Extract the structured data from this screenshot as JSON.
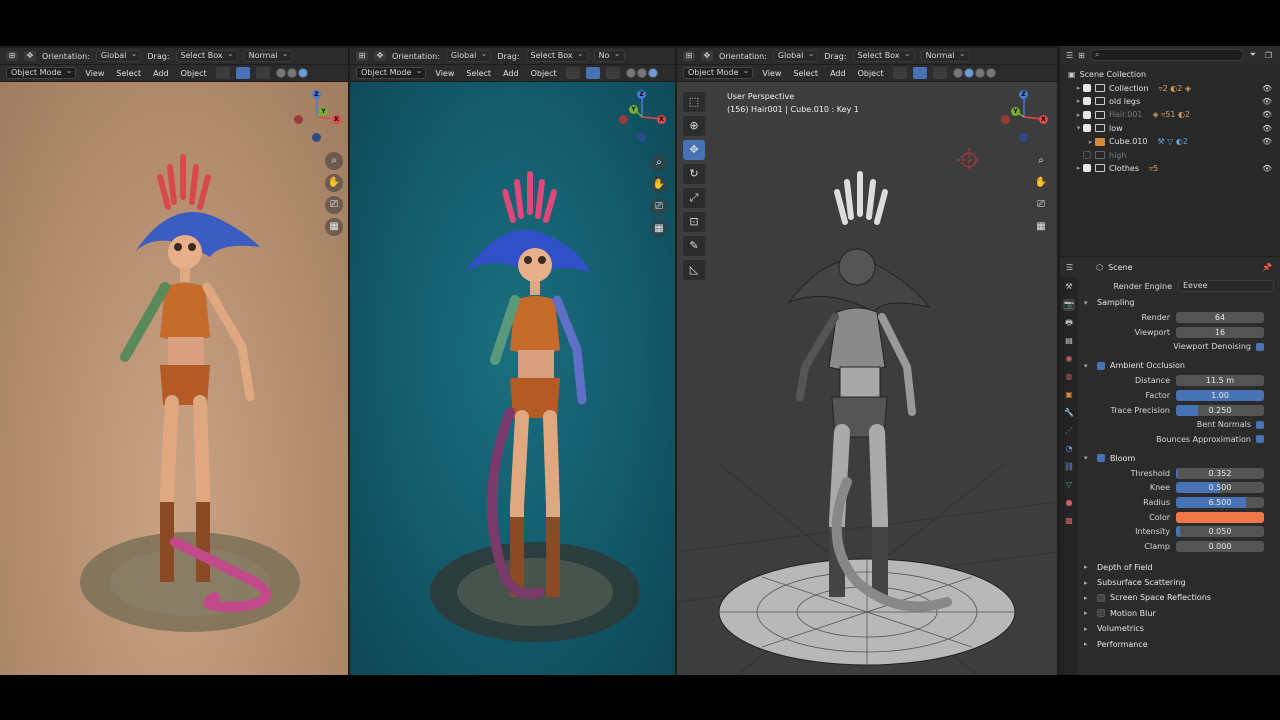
{
  "viewports": [
    {
      "orientation_label": "Orientation:",
      "orientation": "Global",
      "drag_label": "Drag:",
      "drag": "Select Box",
      "pivot": "Normal",
      "mode": "Object Mode",
      "menus": [
        "View",
        "Select",
        "Add",
        "Object"
      ]
    },
    {
      "orientation_label": "Orientation:",
      "orientation": "Global",
      "drag_label": "Drag:",
      "drag": "Select Box",
      "pivot": "No",
      "mode": "Object Mode",
      "menus": [
        "View",
        "Select",
        "Add",
        "Object"
      ]
    },
    {
      "orientation_label": "Orientation:",
      "orientation": "Global",
      "drag_label": "Drag:",
      "drag": "Select Box",
      "pivot": "Normal",
      "mode": "Object Mode",
      "menus": [
        "View",
        "Select",
        "Add",
        "Object"
      ],
      "info_title": "User Perspective",
      "info_sub": "(156) Hair001 | Cube.010 : Key 1"
    }
  ],
  "gizmo": {
    "x": "X",
    "y": "Y",
    "z": "Z"
  },
  "outliner": {
    "root": "Scene Collection",
    "rows": [
      {
        "name": "Collection",
        "dim": false,
        "checked": true,
        "tags": "▿2 ◐2 ◈"
      },
      {
        "name": "old legs",
        "dim": false,
        "checked": true,
        "tags": ""
      },
      {
        "name": "Hair.001",
        "dim": true,
        "checked": true,
        "tags": "◈ ▿51 ◐2"
      },
      {
        "name": "low",
        "dim": false,
        "checked": true,
        "tags": ""
      },
      {
        "name": "Cube.010",
        "dim": false,
        "checked": false,
        "tags": "⚒ ▽ ◐2"
      },
      {
        "name": "high",
        "dim": true,
        "checked": false,
        "tags": ""
      },
      {
        "name": "Clothes",
        "dim": false,
        "checked": true,
        "tags": "▿5"
      }
    ]
  },
  "properties": {
    "context": "Scene",
    "render_engine_label": "Render Engine",
    "render_engine": "Eevee",
    "sampling": {
      "title": "Sampling",
      "render_label": "Render",
      "render": "64",
      "viewport_label": "Viewport",
      "viewport": "16",
      "denoise_label": "Viewport Denoising"
    },
    "ao": {
      "title": "Ambient Occlusion",
      "distance_label": "Distance",
      "distance": "11.5 m",
      "factor_label": "Factor",
      "factor": "1.00",
      "factor_fill": 1.0,
      "trace_label": "Trace Precision",
      "trace": "0.250",
      "trace_fill": 0.25,
      "bent_label": "Bent Normals",
      "bounces_label": "Bounces Approximation"
    },
    "bloom": {
      "title": "Bloom",
      "threshold_label": "Threshold",
      "threshold": "0.352",
      "threshold_fill": 0.02,
      "knee_label": "Knee",
      "knee": "0.500",
      "knee_fill": 0.5,
      "radius_label": "Radius",
      "radius": "6.500",
      "radius_fill": 0.8,
      "color_label": "Color",
      "color": "#f0784a",
      "intensity_label": "Intensity",
      "intensity": "0.050",
      "intensity_fill": 0.05,
      "clamp_label": "Clamp",
      "clamp": "0.000"
    },
    "sections": [
      {
        "title": "Depth of Field",
        "check": false
      },
      {
        "title": "Subsurface Scattering",
        "check": false
      },
      {
        "title": "Screen Space Reflections",
        "check": true
      },
      {
        "title": "Motion Blur",
        "check": true
      },
      {
        "title": "Volumetrics",
        "check": false
      },
      {
        "title": "Performance",
        "check": false
      }
    ]
  }
}
